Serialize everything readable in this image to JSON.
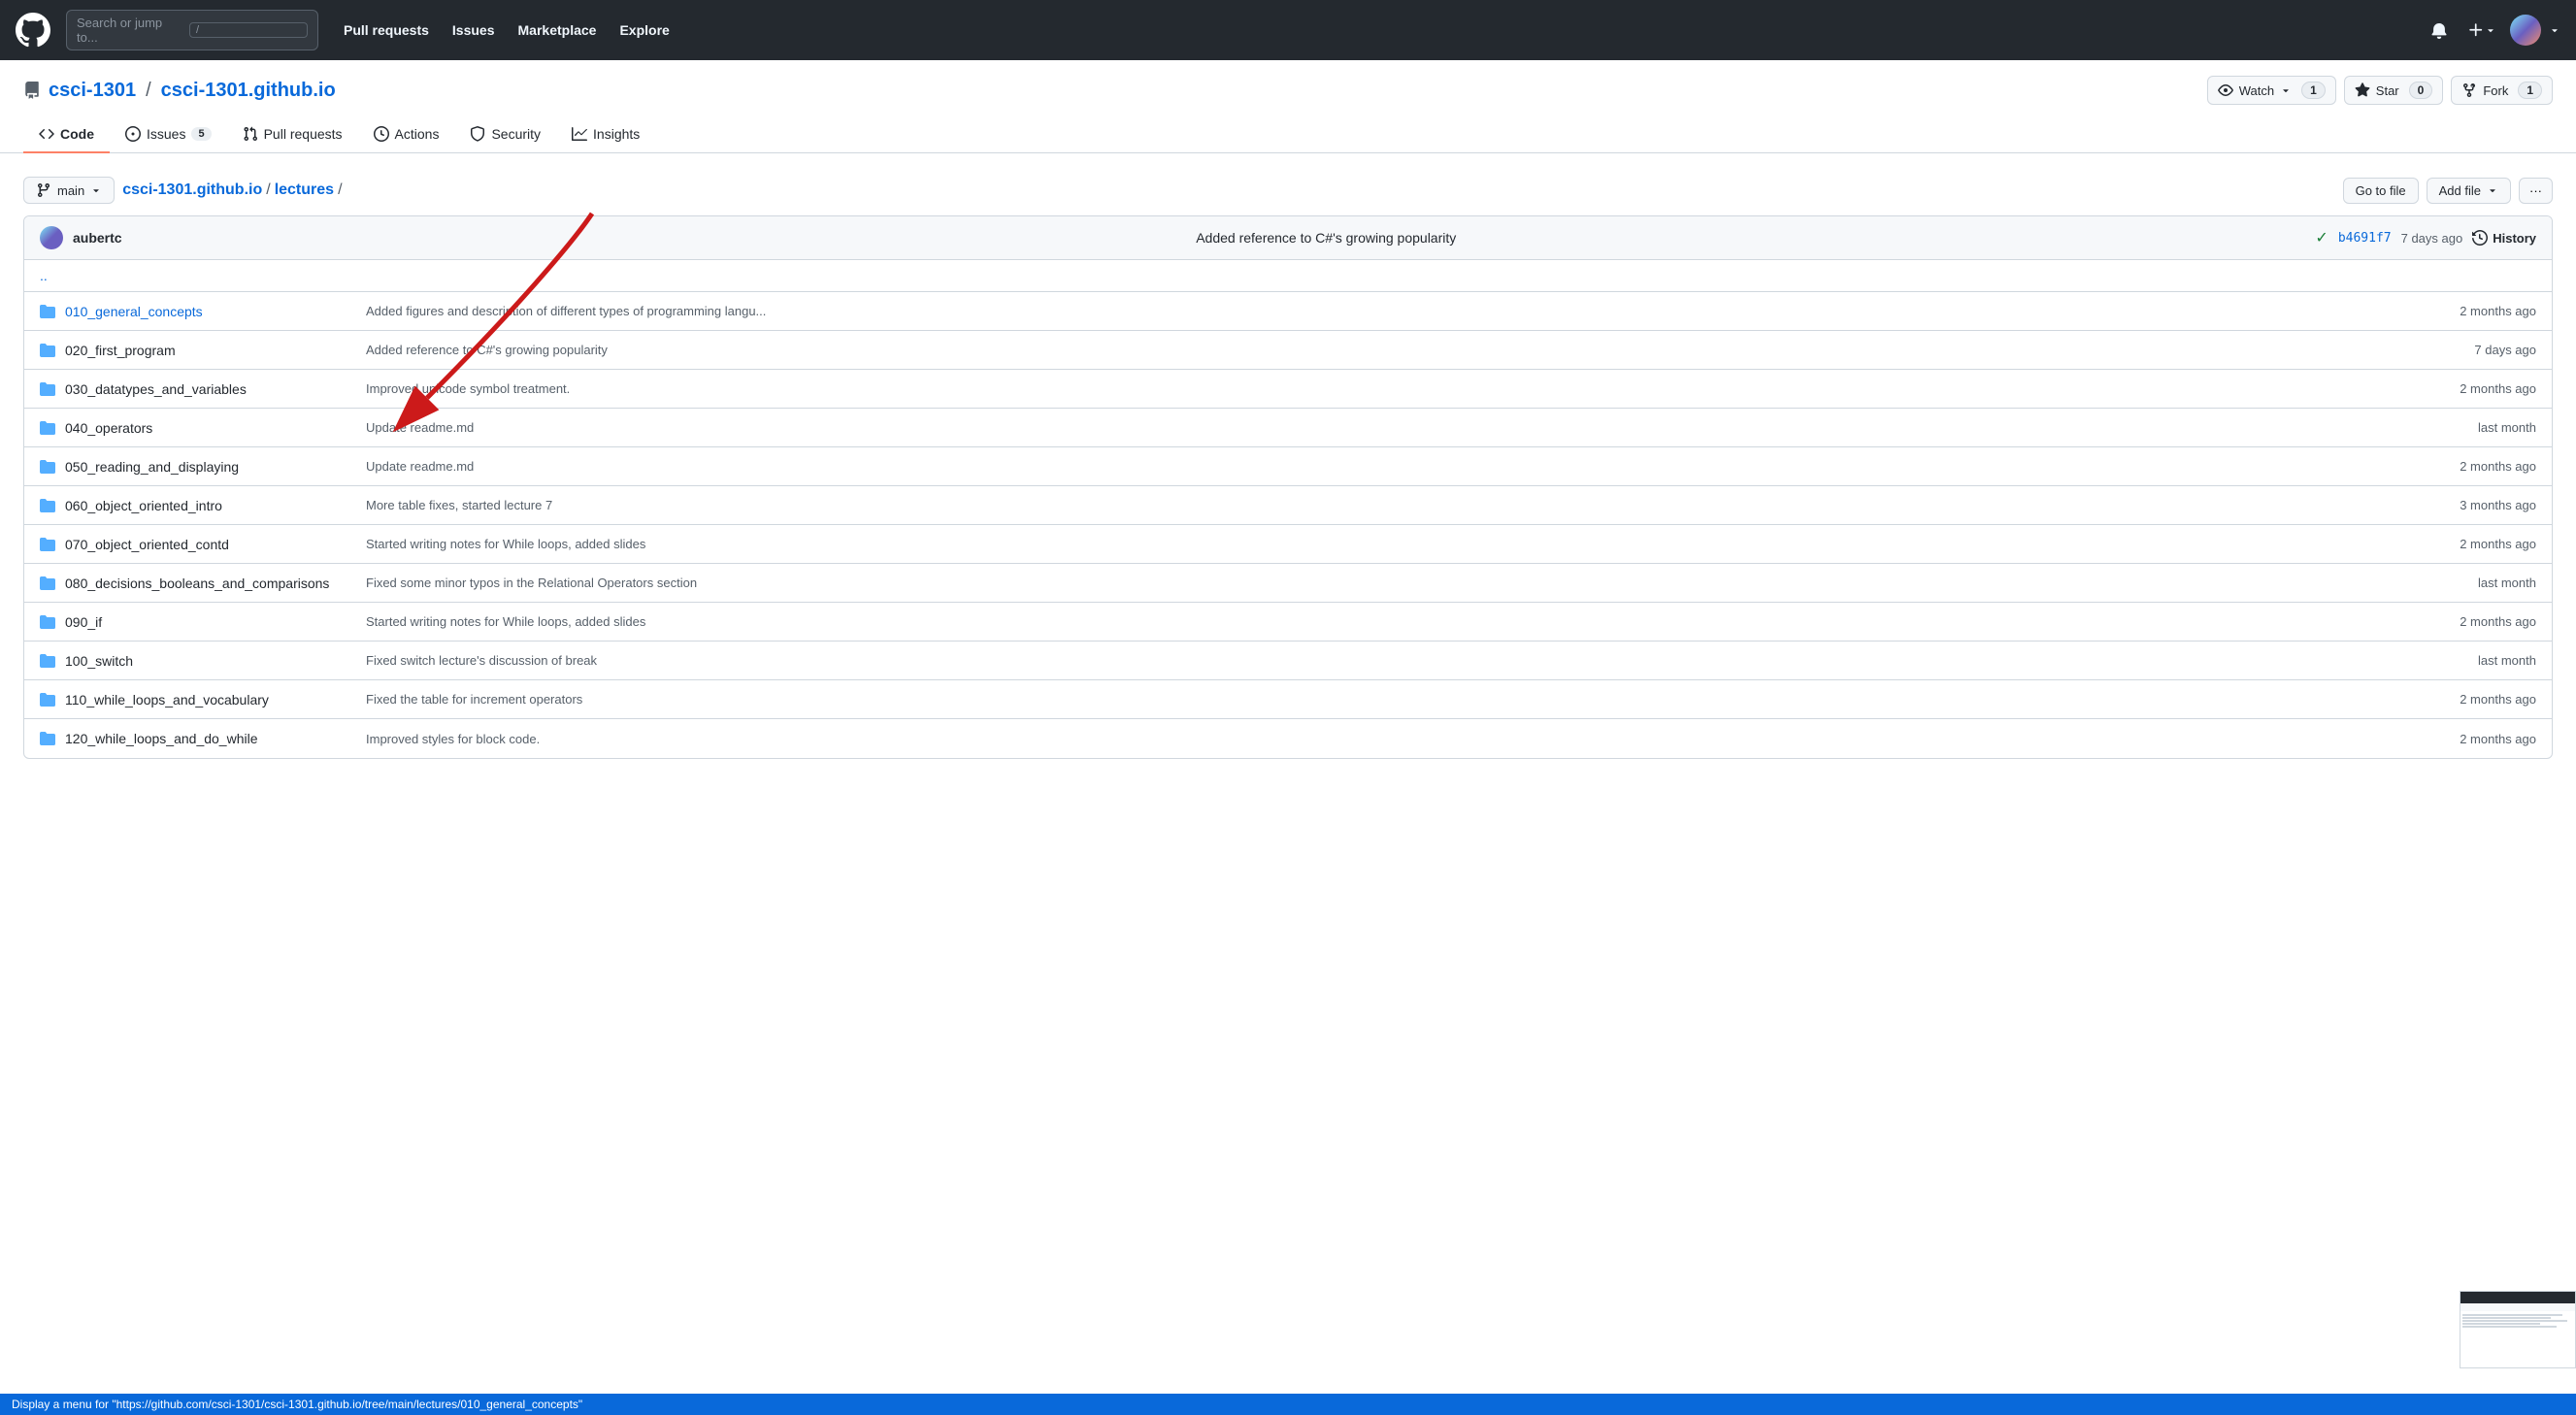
{
  "topnav": {
    "search_placeholder": "Search or jump to...",
    "search_kbd": "/",
    "links": [
      "Pull requests",
      "Issues",
      "Marketplace",
      "Explore"
    ]
  },
  "repo": {
    "owner": "csci-1301",
    "name": "csci-1301.github.io",
    "watch_label": "Watch",
    "watch_count": "1",
    "star_label": "Star",
    "star_count": "0",
    "fork_label": "Fork",
    "fork_count": "1"
  },
  "tabs": [
    {
      "id": "code",
      "label": "Code",
      "active": true
    },
    {
      "id": "issues",
      "label": "Issues",
      "badge": "5"
    },
    {
      "id": "pull-requests",
      "label": "Pull requests"
    },
    {
      "id": "actions",
      "label": "Actions"
    },
    {
      "id": "security",
      "label": "Security"
    },
    {
      "id": "insights",
      "label": "Insights"
    }
  ],
  "branch": {
    "name": "main",
    "icon": "⎇"
  },
  "breadcrumb": {
    "repo": "csci-1301.github.io",
    "path": "lectures",
    "separator": "/"
  },
  "toolbar": {
    "goto_file": "Go to file",
    "add_file": "Add file",
    "more": "···"
  },
  "commit": {
    "author": "aubertc",
    "message": "Added reference to C#'s growing popularity",
    "check": "✓",
    "hash": "b4691f7",
    "time": "7 days ago",
    "history_label": "History"
  },
  "files": [
    {
      "type": "parent",
      "name": ".."
    },
    {
      "type": "folder",
      "name": "010_general_concepts",
      "commit_msg": "Added figures and description of different types of programming langu...",
      "time": "2 months ago",
      "link": true
    },
    {
      "type": "folder",
      "name": "020_first_program",
      "commit_msg": "Added reference to C#'s growing popularity",
      "time": "7 days ago",
      "link": false
    },
    {
      "type": "folder",
      "name": "030_datatypes_and_variables",
      "commit_msg": "Improved unicode symbol treatment.",
      "time": "2 months ago",
      "link": false
    },
    {
      "type": "folder",
      "name": "040_operators",
      "commit_msg": "Update readme.md",
      "time": "last month",
      "link": false
    },
    {
      "type": "folder",
      "name": "050_reading_and_displaying",
      "commit_msg": "Update readme.md",
      "time": "2 months ago",
      "link": false
    },
    {
      "type": "folder",
      "name": "060_object_oriented_intro",
      "commit_msg": "More table fixes, started lecture 7",
      "time": "3 months ago",
      "link": false
    },
    {
      "type": "folder",
      "name": "070_object_oriented_contd",
      "commit_msg": "Started writing notes for While loops, added slides",
      "time": "2 months ago",
      "link": false
    },
    {
      "type": "folder",
      "name": "080_decisions_booleans_and_comparisons",
      "commit_msg": "Fixed some minor typos in the Relational Operators section",
      "time": "last month",
      "link": false
    },
    {
      "type": "folder",
      "name": "090_if",
      "commit_msg": "Started writing notes for While loops, added slides",
      "time": "2 months ago",
      "link": false
    },
    {
      "type": "folder",
      "name": "100_switch",
      "commit_msg": "Fixed switch lecture's discussion of break",
      "time": "last month",
      "link": false
    },
    {
      "type": "folder",
      "name": "110_while_loops_and_vocabulary",
      "commit_msg": "Fixed the table for increment operators",
      "time": "2 months ago",
      "link": false
    },
    {
      "type": "folder",
      "name": "120_while_loops_and_do_while",
      "commit_msg": "Improved styles for block code.",
      "time": "2 months ago",
      "link": false
    }
  ],
  "status_bar": {
    "text": "Display a menu for \"https://github.com/csci-1301/csci-1301.github.io/tree/main/lectures/010_general_concepts\""
  }
}
